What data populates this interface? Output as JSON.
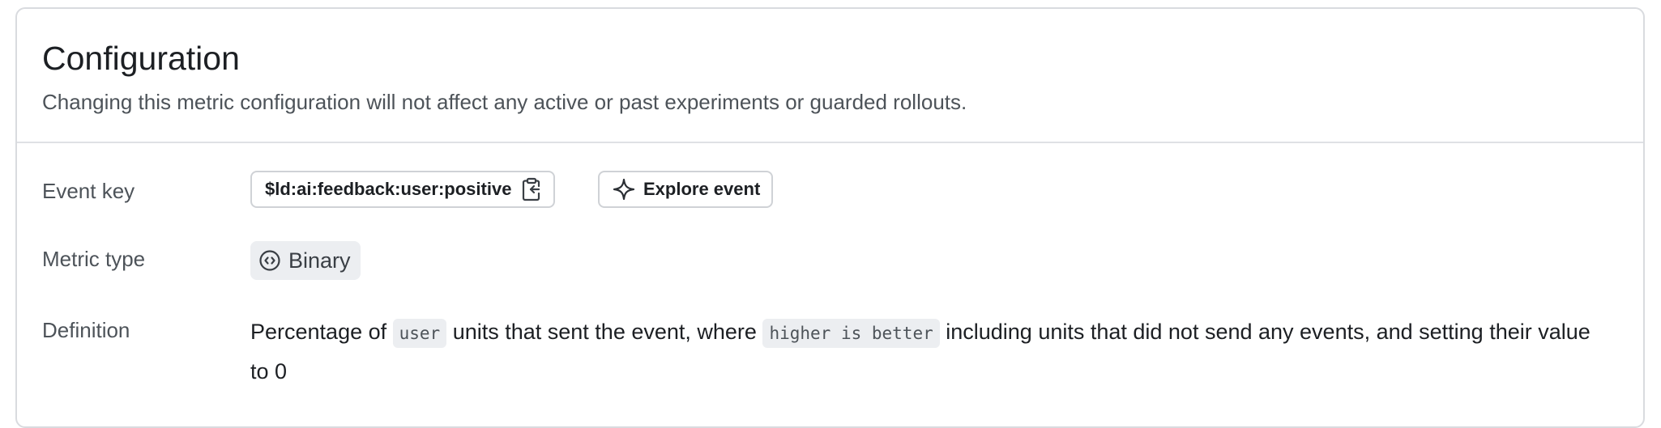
{
  "header": {
    "title": "Configuration",
    "subtitle": "Changing this metric configuration will not affect any active or past experiments or guarded rollouts."
  },
  "event_key": {
    "label": "Event key",
    "value": "$ld:ai:feedback:user:positive",
    "copy_icon": "clipboard-copy-icon",
    "explore_label": "Explore event",
    "explore_icon": "sparkle-icon"
  },
  "metric_type": {
    "label": "Metric type",
    "value": "Binary",
    "icon": "binary-circle-icon"
  },
  "definition": {
    "label": "Definition",
    "text_1": "Percentage of ",
    "code_1": "user",
    "text_2": " units that sent the event, where ",
    "code_2": "higher is better",
    "text_3": " including units that did not send any events, and setting their value to 0"
  },
  "colors": {
    "border": "#d9dbdf",
    "chip_bg": "#eceef1",
    "muted_text": "#4d5359"
  }
}
